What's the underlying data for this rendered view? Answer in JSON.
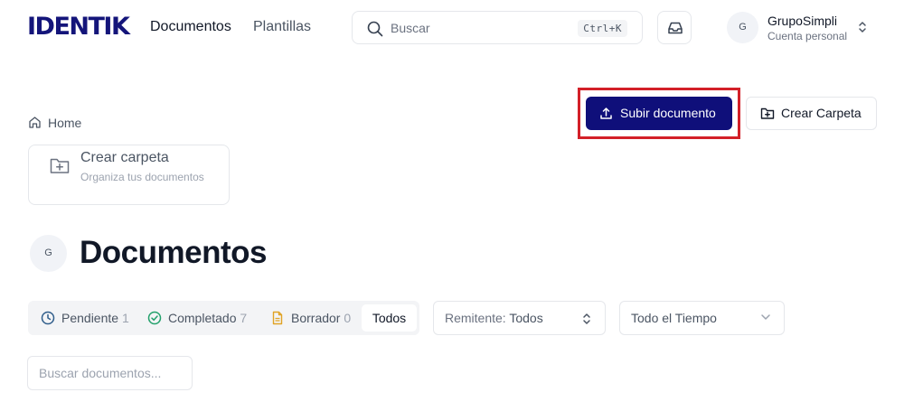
{
  "brand": {
    "logo_text": "IDENTIK",
    "color": "#14157a"
  },
  "nav": {
    "documents": "Documentos",
    "templates": "Plantillas"
  },
  "search": {
    "placeholder": "Buscar",
    "shortcut": "Ctrl+K"
  },
  "account": {
    "avatar": "G",
    "name": "GrupoSimpli",
    "type": "Cuenta personal"
  },
  "actions": {
    "upload_label": "Subir documento",
    "create_folder_label": "Crear Carpeta",
    "upload_color": "#0f0f7a",
    "highlight_color": "#d32028"
  },
  "breadcrumb": {
    "home": "Home"
  },
  "folder_card": {
    "title": "Crear carpeta",
    "subtitle": "Organiza tus documentos"
  },
  "page": {
    "avatar": "G",
    "title": "Documentos"
  },
  "filters": {
    "status": [
      {
        "label": "Pendiente",
        "count": "1",
        "icon": "clock-icon",
        "color": "#2f5d8a"
      },
      {
        "label": "Completado",
        "count": "7",
        "icon": "check-circle-icon",
        "color": "#22a06b"
      },
      {
        "label": "Borrador",
        "count": "0",
        "icon": "file-icon",
        "color": "#e0a325"
      },
      {
        "label": "Todos",
        "active": true
      }
    ],
    "sender_label": "Remitente:",
    "sender_value": "Todos",
    "time_value": "Todo el Tiempo"
  },
  "doc_search": {
    "placeholder": "Buscar documentos..."
  }
}
